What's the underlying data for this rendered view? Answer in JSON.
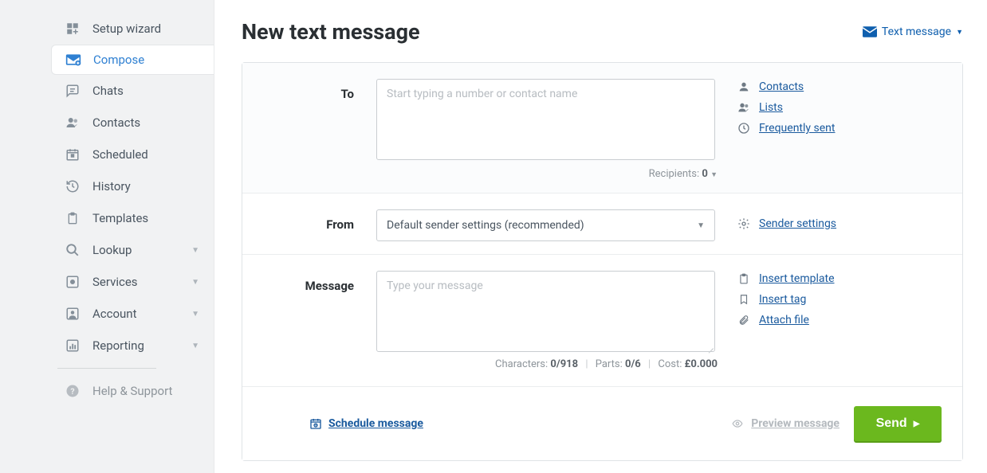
{
  "sidebar": {
    "items": [
      {
        "label": "Setup wizard"
      },
      {
        "label": "Compose"
      },
      {
        "label": "Chats"
      },
      {
        "label": "Contacts"
      },
      {
        "label": "Scheduled"
      },
      {
        "label": "History"
      },
      {
        "label": "Templates"
      },
      {
        "label": "Lookup"
      },
      {
        "label": "Services"
      },
      {
        "label": "Account"
      },
      {
        "label": "Reporting"
      }
    ],
    "help_label": "Help & Support"
  },
  "header": {
    "title": "New text message",
    "type_switch": "Text message"
  },
  "form": {
    "to_label": "To",
    "to_placeholder": "Start typing a number or contact name",
    "recipients_label": "Recipients:",
    "recipients_count": "0",
    "from_label": "From",
    "from_value": "Default sender settings (recommended)",
    "message_label": "Message",
    "message_placeholder": "Type your message",
    "characters_label": "Characters:",
    "characters_value": "0/918",
    "parts_label": "Parts:",
    "parts_value": "0/6",
    "cost_label": "Cost:",
    "cost_value": "£0.000"
  },
  "links": {
    "contacts": "Contacts",
    "lists": "Lists",
    "frequently_sent": "Frequently sent",
    "sender_settings": "Sender settings",
    "insert_template": "Insert template",
    "insert_tag": "Insert tag",
    "attach_file": "Attach file"
  },
  "footer": {
    "schedule": "Schedule message",
    "preview": "Preview message",
    "send": "Send"
  }
}
